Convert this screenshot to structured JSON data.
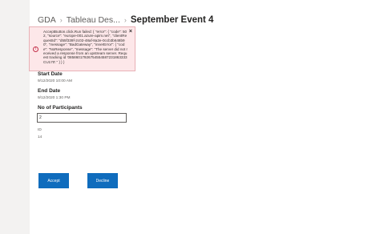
{
  "breadcrumb": {
    "items": [
      "GDA",
      "Tableau Des..."
    ],
    "separator": "›",
    "current": "September Event 4"
  },
  "error": {
    "message": "AcceptButton.click.Run failed: { \"error\": { \"code\": 502, \"source\": \"europe-001.azure-apim.net\", \"clientRequestId\": \"d55f339f-2c02-48af-8a2e-0ccb3b648b90\", \"message\": \"BadGateway\", \"innerError\": { \"code\": \"NoResponse\", \"message\": \"The server did not received a response from an upstream server. Request tracking id '08586017926754554587231863333CU170'.\" } } }",
    "close_glyph": "×",
    "icon_glyph": "!"
  },
  "fields": {
    "start_date": {
      "label": "Start Date",
      "value": "9/12/2020 10:00 AM"
    },
    "end_date": {
      "label": "End Date",
      "value": "9/12/2020 1:30 PM"
    },
    "participants": {
      "label": "No of Participants",
      "value": "2"
    },
    "id": {
      "label": "ID",
      "value": "14"
    }
  },
  "buttons": {
    "accept": "Accept",
    "decline": "Decline"
  },
  "colors": {
    "accent": "#0f6cbd",
    "error_bg": "#fde7e9",
    "error_border": "#e8b1b6",
    "error_icon": "#c4314b"
  }
}
